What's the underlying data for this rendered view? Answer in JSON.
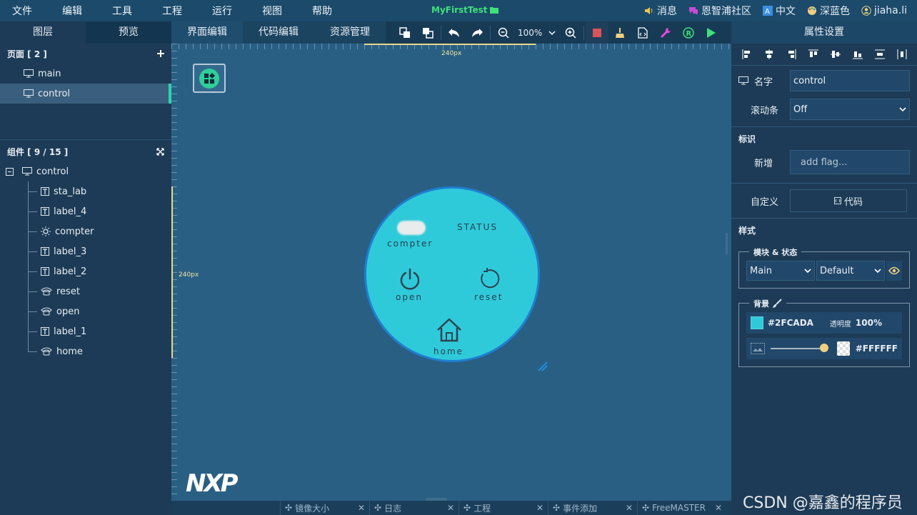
{
  "menubar": {
    "items": [
      "文件",
      "编辑",
      "工具",
      "工程",
      "运行",
      "视图",
      "帮助"
    ],
    "app_title": "MyFirstTest",
    "right": {
      "messages": "消息",
      "community": "恩智浦社区",
      "language": "中文",
      "theme": "深蓝色",
      "user": "jiaha.li"
    }
  },
  "left_tabs": [
    "图层",
    "预览"
  ],
  "center_tabs": [
    "界面编辑",
    "代码编辑",
    "资源管理"
  ],
  "toolbar": {
    "zoom": "100%"
  },
  "pages": {
    "header": "页面 [ 2 ]",
    "items": [
      "main",
      "control"
    ],
    "selected": "control"
  },
  "components": {
    "header": "组件 [ 9 / 15 ]",
    "root": "control",
    "items": [
      {
        "name": "sta_lab",
        "icon": "label-icon"
      },
      {
        "name": "label_4",
        "icon": "label-icon"
      },
      {
        "name": "compter",
        "icon": "led-icon"
      },
      {
        "name": "label_3",
        "icon": "label-icon"
      },
      {
        "name": "label_2",
        "icon": "label-icon"
      },
      {
        "name": "reset",
        "icon": "imgbtn-icon"
      },
      {
        "name": "open",
        "icon": "imgbtn-icon"
      },
      {
        "name": "label_1",
        "icon": "label-icon"
      },
      {
        "name": "home",
        "icon": "imgbtn-icon"
      }
    ]
  },
  "canvas": {
    "ruler_x_label": "240px",
    "ruler_y_label": "240px",
    "widget_labels": {
      "compter": "compter",
      "status": "STATUS",
      "open": "open",
      "reset": "reset",
      "home": "home"
    },
    "logo": "NXP"
  },
  "bottom_tabs": [
    "镜像大小",
    "日志",
    "工程",
    "事件添加",
    "FreeMASTER"
  ],
  "properties": {
    "header": "属性设置",
    "name_label": "名字",
    "name_value": "control",
    "scroll_label": "滚动条",
    "scroll_value": "Off",
    "flag_section": "标识",
    "flag_add_label": "新增",
    "flag_placeholder": "add flag...",
    "custom_label": "自定义",
    "code_button": "代码",
    "style_section": "样式",
    "module_group": "模块 & 状态",
    "module_value": "Main",
    "state_value": "Default",
    "bg_group": "背景",
    "bg_color": "#2FCADA",
    "opacity_label": "透明度",
    "opacity_value": "100%",
    "image_color": "#FFFFFF"
  },
  "watermark": "CSDN @嘉鑫的程序员",
  "colors": {
    "accent": "#27d6b3",
    "widget_bg": "#2FCADA",
    "circle_border": "#1e7fd0",
    "app_title": "#3fe07a"
  }
}
